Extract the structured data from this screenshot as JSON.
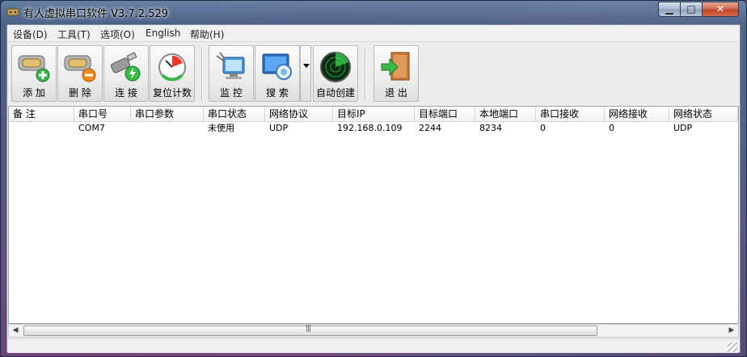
{
  "window": {
    "title": "有人虚拟串口软件 V3.7.2.529",
    "min": "▁",
    "max": "□",
    "close": "✕"
  },
  "menu": [
    "设备(D)",
    "工具(T)",
    "选项(O)",
    "English",
    "帮助(H)"
  ],
  "toolbar": {
    "add": "添 加",
    "delete": "删 除",
    "connect": "连 接",
    "reset": "复位计数",
    "monitor": "监 控",
    "search": "搜 索",
    "autocreate": "自动创建",
    "exit": "退 出"
  },
  "columns": [
    "备 注",
    "串口号",
    "串口参数",
    "串口状态",
    "网络协议",
    "目标IP",
    "目标端口",
    "本地端口",
    "串口接收",
    "网络接收",
    "网络状态"
  ],
  "rows": [
    [
      "",
      "COM7",
      "",
      "未使用",
      "UDP",
      "192.168.0.109",
      "2244",
      "8234",
      "0",
      "0",
      "UDP"
    ]
  ],
  "scrollbar": {
    "left": "◀",
    "right": "▶",
    "grip": "|||"
  },
  "colors": {
    "titlebar": "#5a6f8f",
    "client": "#f0f0f0",
    "close_button": "#c2462d"
  }
}
